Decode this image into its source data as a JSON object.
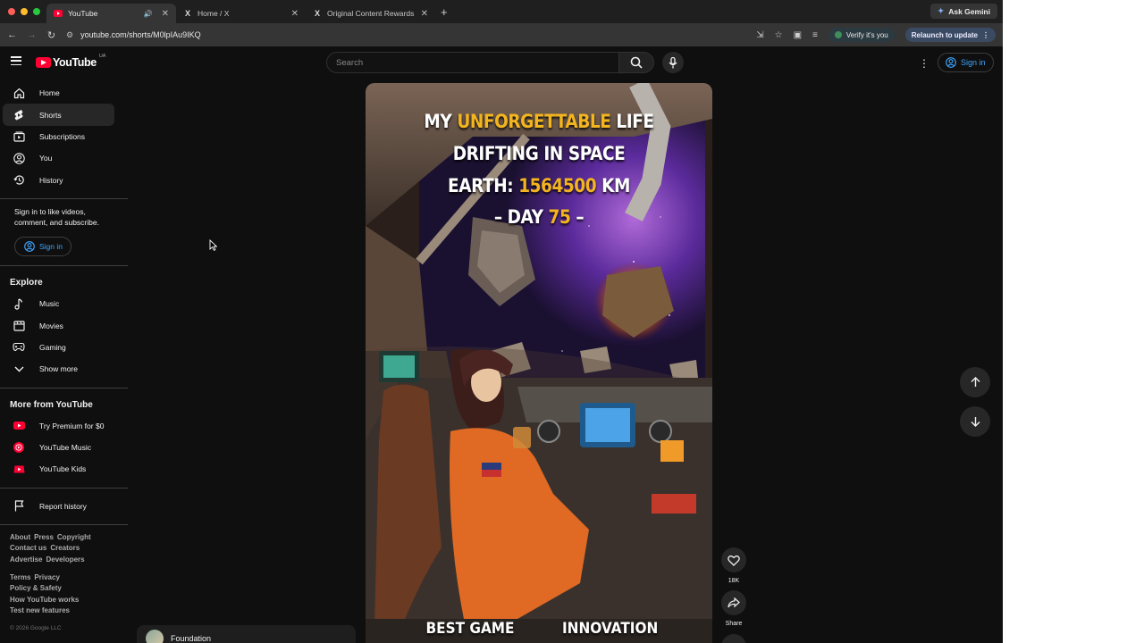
{
  "browser": {
    "tabs": [
      {
        "title": "YouTube",
        "active": true,
        "favicon": "youtube-favicon",
        "audio": true
      },
      {
        "title": "Home / X",
        "active": false,
        "favicon": "x-favicon"
      },
      {
        "title": "Original Content Rewards App",
        "active": false,
        "favicon": "x-favicon"
      }
    ],
    "gemini_label": "Ask Gemini",
    "url": "youtube.com/shorts/M0lpIAu9IKQ",
    "verify_label": "Verify it's you",
    "relaunch_label": "Relaunch to update"
  },
  "masthead": {
    "logo_text": "YouTube",
    "country_code": "UA",
    "search_placeholder": "Search",
    "signin_label": "Sign in"
  },
  "sidebar": {
    "main": [
      {
        "label": "Home",
        "icon": "home-icon"
      },
      {
        "label": "Shorts",
        "icon": "shorts-icon",
        "active": true
      },
      {
        "label": "Subscriptions",
        "icon": "subscriptions-icon"
      },
      {
        "label": "You",
        "icon": "you-icon"
      },
      {
        "label": "History",
        "icon": "history-icon"
      }
    ],
    "signin_prompt": "Sign in to like videos, comment, and subscribe.",
    "signin_label": "Sign in",
    "explore_title": "Explore",
    "explore": [
      {
        "label": "Music",
        "icon": "music-icon"
      },
      {
        "label": "Movies",
        "icon": "movies-icon"
      },
      {
        "label": "Gaming",
        "icon": "gaming-icon"
      },
      {
        "label": "Show more",
        "icon": "chevron-down-icon"
      }
    ],
    "more_title": "More from YouTube",
    "more": [
      {
        "label": "Try Premium for $0",
        "icon": "youtube-premium-icon"
      },
      {
        "label": "YouTube Music",
        "icon": "youtube-music-icon"
      },
      {
        "label": "YouTube Kids",
        "icon": "youtube-kids-icon"
      }
    ],
    "report_history": "Report history",
    "footer_links_1": [
      "About",
      "Press",
      "Copyright",
      "Contact us",
      "Creators",
      "Advertise",
      "Developers"
    ],
    "footer_links_2": [
      "Terms",
      "Privacy",
      "Policy & Safety",
      "How YouTube works",
      "Test new features"
    ],
    "copyright": "© 2026 Google LLC"
  },
  "short": {
    "line1_a": "MY ",
    "line1_hl": "UNFORGETTABLE",
    "line1_b": " LIFE",
    "line2": "DRIFTING IN SPACE",
    "line3_a": "EARTH: ",
    "line3_hl": "1564500",
    "line3_b": " KM",
    "line4_a": "– DAY ",
    "line4_hl": "75",
    "line4_b": " –",
    "bottom_left": "BEST GAME",
    "bottom_right": "INNOVATION",
    "highlight_color": "#f3b51f",
    "likes": "18K",
    "share_label": "Share"
  },
  "channel_card": {
    "name": "Foundation"
  }
}
